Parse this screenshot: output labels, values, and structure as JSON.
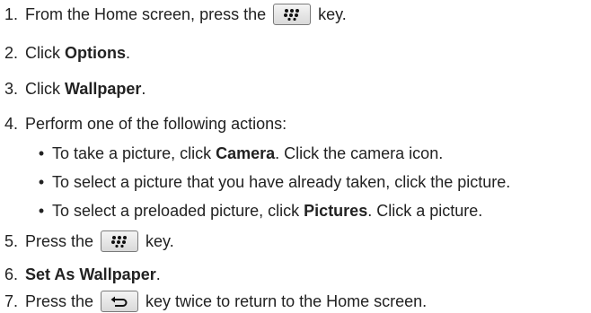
{
  "steps": [
    {
      "num": "1.",
      "pre": "From the Home screen, press the",
      "post": "key.",
      "key": "blackberry-menu-icon"
    },
    {
      "num": "2.",
      "pre": "Click",
      "bold": "Options",
      "post": "."
    },
    {
      "num": "3.",
      "pre": "Click",
      "bold": "Wallpaper",
      "post": "."
    },
    {
      "num": "4.",
      "text": "Perform one of the following actions:"
    },
    {
      "num": "5.",
      "pre": "Press the",
      "post": "key.",
      "key": "blackberry-menu-icon"
    },
    {
      "num": "6.",
      "bold": "Set As Wallpaper",
      "post": "."
    },
    {
      "num": "7.",
      "pre": "Press the",
      "post": "key twice to return to the Home screen.",
      "key": "escape-back-icon"
    }
  ],
  "bullets": [
    {
      "dot": "•",
      "pre": "To take a picture, click",
      "bold": "Camera",
      "post": ". Click the camera icon."
    },
    {
      "dot": "•",
      "text": "To select a picture that you have already taken, click the picture."
    },
    {
      "dot": "•",
      "pre": "To select a preloaded picture, click",
      "bold": "Pictures",
      "post": ". Click a picture."
    }
  ]
}
